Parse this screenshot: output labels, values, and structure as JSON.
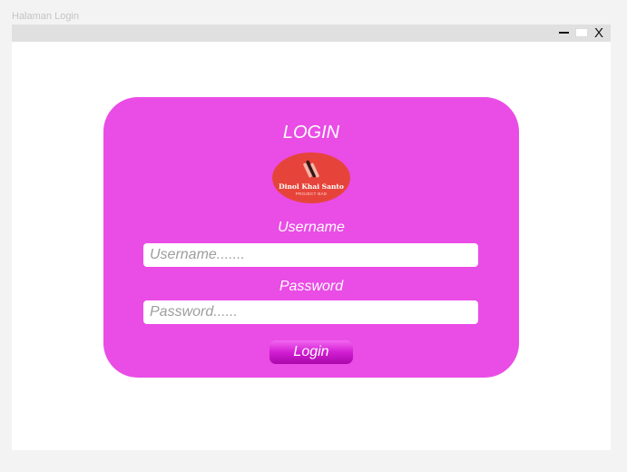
{
  "caption": "Halaman Login",
  "window": {
    "close_label": "X",
    "minimize_icon": "minimize-icon",
    "maximize_icon": "maximize-icon"
  },
  "login": {
    "title": "LOGIN",
    "logo": {
      "name": "Dinol Khai Santo",
      "subtitle": "PROJECT BAD",
      "background": "#e6443a"
    },
    "username_label": "Username",
    "username_placeholder": "Username.......",
    "username_value": "",
    "password_label": "Password",
    "password_placeholder": "Password......",
    "password_value": "",
    "button_label": "Login"
  },
  "colors": {
    "card": "#ea4ce6",
    "button": "#d21ed3",
    "titlebar": "#e0e0e0"
  }
}
